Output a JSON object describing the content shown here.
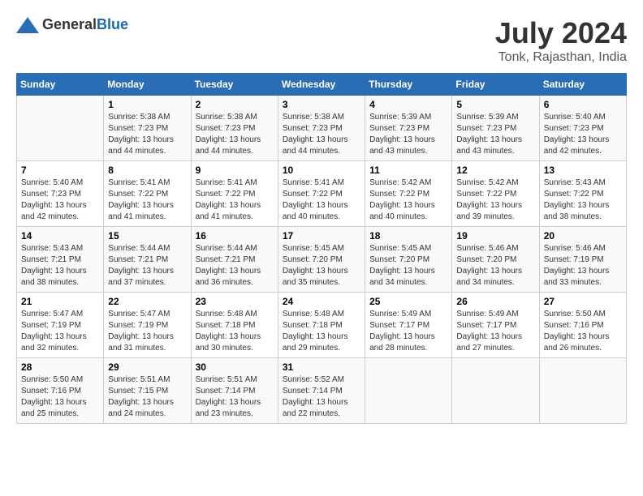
{
  "header": {
    "logo_general": "General",
    "logo_blue": "Blue",
    "month_year": "July 2024",
    "location": "Tonk, Rajasthan, India"
  },
  "days_of_week": [
    "Sunday",
    "Monday",
    "Tuesday",
    "Wednesday",
    "Thursday",
    "Friday",
    "Saturday"
  ],
  "weeks": [
    [
      {
        "day": "",
        "info": ""
      },
      {
        "day": "1",
        "info": "Sunrise: 5:38 AM\nSunset: 7:23 PM\nDaylight: 13 hours\nand 44 minutes."
      },
      {
        "day": "2",
        "info": "Sunrise: 5:38 AM\nSunset: 7:23 PM\nDaylight: 13 hours\nand 44 minutes."
      },
      {
        "day": "3",
        "info": "Sunrise: 5:38 AM\nSunset: 7:23 PM\nDaylight: 13 hours\nand 44 minutes."
      },
      {
        "day": "4",
        "info": "Sunrise: 5:39 AM\nSunset: 7:23 PM\nDaylight: 13 hours\nand 43 minutes."
      },
      {
        "day": "5",
        "info": "Sunrise: 5:39 AM\nSunset: 7:23 PM\nDaylight: 13 hours\nand 43 minutes."
      },
      {
        "day": "6",
        "info": "Sunrise: 5:40 AM\nSunset: 7:23 PM\nDaylight: 13 hours\nand 42 minutes."
      }
    ],
    [
      {
        "day": "7",
        "info": "Sunrise: 5:40 AM\nSunset: 7:23 PM\nDaylight: 13 hours\nand 42 minutes."
      },
      {
        "day": "8",
        "info": "Sunrise: 5:41 AM\nSunset: 7:22 PM\nDaylight: 13 hours\nand 41 minutes."
      },
      {
        "day": "9",
        "info": "Sunrise: 5:41 AM\nSunset: 7:22 PM\nDaylight: 13 hours\nand 41 minutes."
      },
      {
        "day": "10",
        "info": "Sunrise: 5:41 AM\nSunset: 7:22 PM\nDaylight: 13 hours\nand 40 minutes."
      },
      {
        "day": "11",
        "info": "Sunrise: 5:42 AM\nSunset: 7:22 PM\nDaylight: 13 hours\nand 40 minutes."
      },
      {
        "day": "12",
        "info": "Sunrise: 5:42 AM\nSunset: 7:22 PM\nDaylight: 13 hours\nand 39 minutes."
      },
      {
        "day": "13",
        "info": "Sunrise: 5:43 AM\nSunset: 7:22 PM\nDaylight: 13 hours\nand 38 minutes."
      }
    ],
    [
      {
        "day": "14",
        "info": "Sunrise: 5:43 AM\nSunset: 7:21 PM\nDaylight: 13 hours\nand 38 minutes."
      },
      {
        "day": "15",
        "info": "Sunrise: 5:44 AM\nSunset: 7:21 PM\nDaylight: 13 hours\nand 37 minutes."
      },
      {
        "day": "16",
        "info": "Sunrise: 5:44 AM\nSunset: 7:21 PM\nDaylight: 13 hours\nand 36 minutes."
      },
      {
        "day": "17",
        "info": "Sunrise: 5:45 AM\nSunset: 7:20 PM\nDaylight: 13 hours\nand 35 minutes."
      },
      {
        "day": "18",
        "info": "Sunrise: 5:45 AM\nSunset: 7:20 PM\nDaylight: 13 hours\nand 34 minutes."
      },
      {
        "day": "19",
        "info": "Sunrise: 5:46 AM\nSunset: 7:20 PM\nDaylight: 13 hours\nand 34 minutes."
      },
      {
        "day": "20",
        "info": "Sunrise: 5:46 AM\nSunset: 7:19 PM\nDaylight: 13 hours\nand 33 minutes."
      }
    ],
    [
      {
        "day": "21",
        "info": "Sunrise: 5:47 AM\nSunset: 7:19 PM\nDaylight: 13 hours\nand 32 minutes."
      },
      {
        "day": "22",
        "info": "Sunrise: 5:47 AM\nSunset: 7:19 PM\nDaylight: 13 hours\nand 31 minutes."
      },
      {
        "day": "23",
        "info": "Sunrise: 5:48 AM\nSunset: 7:18 PM\nDaylight: 13 hours\nand 30 minutes."
      },
      {
        "day": "24",
        "info": "Sunrise: 5:48 AM\nSunset: 7:18 PM\nDaylight: 13 hours\nand 29 minutes."
      },
      {
        "day": "25",
        "info": "Sunrise: 5:49 AM\nSunset: 7:17 PM\nDaylight: 13 hours\nand 28 minutes."
      },
      {
        "day": "26",
        "info": "Sunrise: 5:49 AM\nSunset: 7:17 PM\nDaylight: 13 hours\nand 27 minutes."
      },
      {
        "day": "27",
        "info": "Sunrise: 5:50 AM\nSunset: 7:16 PM\nDaylight: 13 hours\nand 26 minutes."
      }
    ],
    [
      {
        "day": "28",
        "info": "Sunrise: 5:50 AM\nSunset: 7:16 PM\nDaylight: 13 hours\nand 25 minutes."
      },
      {
        "day": "29",
        "info": "Sunrise: 5:51 AM\nSunset: 7:15 PM\nDaylight: 13 hours\nand 24 minutes."
      },
      {
        "day": "30",
        "info": "Sunrise: 5:51 AM\nSunset: 7:14 PM\nDaylight: 13 hours\nand 23 minutes."
      },
      {
        "day": "31",
        "info": "Sunrise: 5:52 AM\nSunset: 7:14 PM\nDaylight: 13 hours\nand 22 minutes."
      },
      {
        "day": "",
        "info": ""
      },
      {
        "day": "",
        "info": ""
      },
      {
        "day": "",
        "info": ""
      }
    ]
  ]
}
